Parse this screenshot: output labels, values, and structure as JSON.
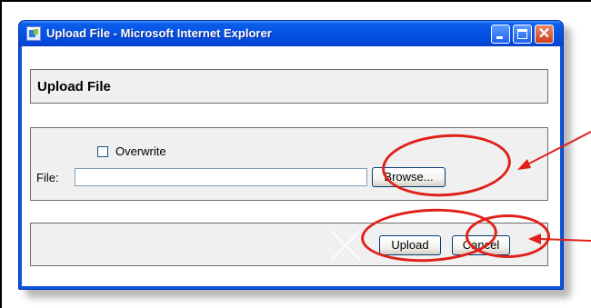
{
  "window": {
    "title": "Upload File - Microsoft Internet Explorer"
  },
  "titlebar_buttons": [
    "minimize-icon",
    "maximize-icon",
    "close-icon"
  ],
  "header": {
    "title": "Upload File"
  },
  "form": {
    "overwrite_label": "Overwrite",
    "overwrite_checked": false,
    "file_label": "File:",
    "file_value": "",
    "browse_label": "Browse..."
  },
  "actions": {
    "upload_label": "Upload",
    "cancel_label": "Cancel"
  },
  "annotations": {
    "color": "#e0201a"
  }
}
